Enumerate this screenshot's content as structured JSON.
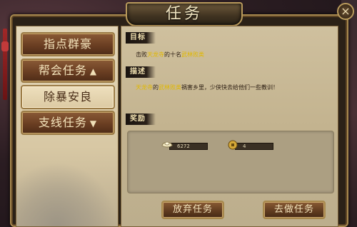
{
  "window": {
    "title": "任务",
    "close_glyph": "×"
  },
  "sidebar": {
    "tabs": [
      {
        "label": "指点群豪",
        "state": "collapsed"
      },
      {
        "label": "帮会任务",
        "arrow": "▲",
        "state": "expanded"
      },
      {
        "label": "除暴安良",
        "state": "selected"
      },
      {
        "label": "支线任务",
        "arrow": "▼",
        "state": "collapsed"
      }
    ]
  },
  "quest": {
    "goal_label": "目标",
    "goal": {
      "pre": "击败",
      "place": "天龙寺",
      "mid": "的十名",
      "enemy": "武林败类"
    },
    "desc_label": "描述",
    "desc": {
      "place": "天龙寺",
      "mid1": "的",
      "enemy": "武林败类",
      "rest": "祸害乡里，少侠快去给他们一些教训！"
    },
    "reward_label": "奖励",
    "rewards": [
      {
        "icon": "silver-ingot-icon",
        "value": "6272"
      },
      {
        "icon": "coin-icon",
        "value": "4"
      }
    ]
  },
  "actions": {
    "abandon_label": "放弃任务",
    "go_label": "去做任务"
  },
  "colors": {
    "highlight_yellow": "#e0b800",
    "highlight_green": "#3a8a16",
    "frame_gold": "#a8894f"
  }
}
